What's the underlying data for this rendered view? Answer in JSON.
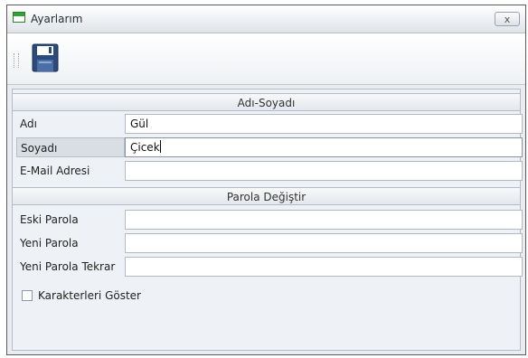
{
  "window": {
    "title": "Ayarlarım",
    "close_label": "x"
  },
  "toolbar": {
    "save_icon": "floppy-disk-icon"
  },
  "group_name": {
    "header": "Adı-Soyadı",
    "fields": [
      {
        "label": "Adı",
        "value": ""
      },
      {
        "label": "Soyadı",
        "value": "Çicek"
      },
      {
        "label": "E-Mail Adresi",
        "value": ""
      }
    ],
    "first_value": "Gül"
  },
  "group_password": {
    "header": "Parola Değiştir",
    "fields": [
      {
        "label": "Eski Parola",
        "value": ""
      },
      {
        "label": "Yeni Parola",
        "value": ""
      },
      {
        "label": "Yeni Parola Tekrar",
        "value": ""
      }
    ]
  },
  "show_chars": {
    "label": "Karakterleri Göster",
    "checked": false
  }
}
